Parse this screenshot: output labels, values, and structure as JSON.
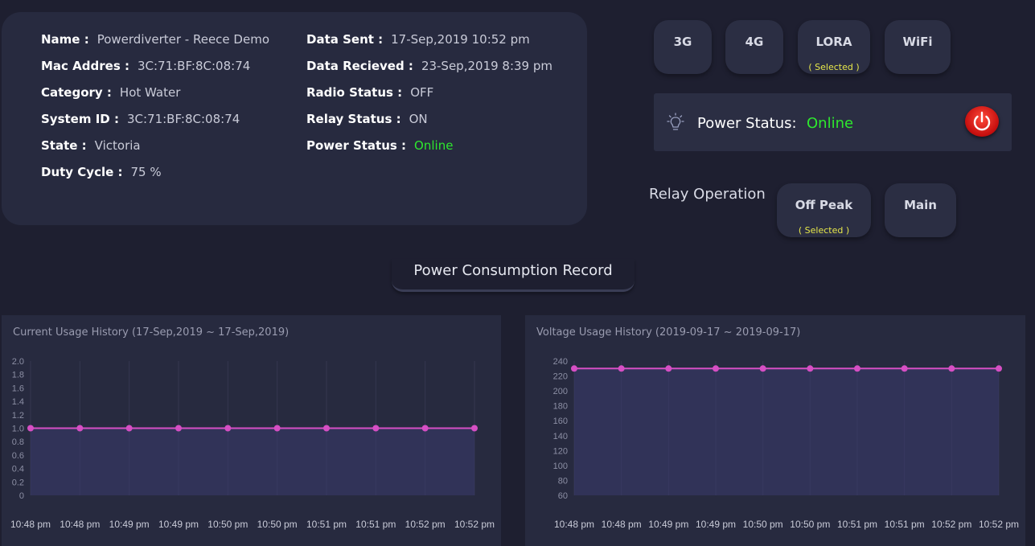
{
  "device": {
    "left": [
      {
        "label": "Name :",
        "value": "Powerdiverter - Reece Demo"
      },
      {
        "label": "Mac Addres :",
        "value": "3C:71:BF:8C:08:74"
      },
      {
        "label": "Category :",
        "value": "Hot Water"
      },
      {
        "label": "System ID :",
        "value": "3C:71:BF:8C:08:74"
      },
      {
        "label": "State :",
        "value": "Victoria"
      },
      {
        "label": "Duty Cycle :",
        "value": "75 %"
      }
    ],
    "right": [
      {
        "label": "Data Sent :",
        "value": "17-Sep,2019 10:52 pm"
      },
      {
        "label": "Data Recieved :",
        "value": "23-Sep,2019 8:39 pm"
      },
      {
        "label": "Radio Status :",
        "value": "OFF"
      },
      {
        "label": "Relay Status :",
        "value": "ON"
      },
      {
        "label": "Power Status :",
        "value": "Online"
      }
    ]
  },
  "network": {
    "buttons": [
      "3G",
      "4G",
      "LORA",
      "WiFi"
    ],
    "selected_note": "( Selected )"
  },
  "power_panel": {
    "label": "Power Status:",
    "value": "Online"
  },
  "relay": {
    "title": "Relay Operation",
    "buttons": [
      "Off Peak",
      "Main"
    ],
    "selected_note": "( Selected )"
  },
  "section_title": "Power Consumption Record",
  "colors": {
    "online": "#2ee82e",
    "selected": "#e6e74a",
    "series": "#d64fc4",
    "power_button": "#d21010"
  },
  "chart_data": [
    {
      "type": "area",
      "title": "Current Usage History (17-Sep,2019 ~ 17-Sep,2019)",
      "categories": [
        "10:48 pm",
        "10:48 pm",
        "10:49 pm",
        "10:49 pm",
        "10:50 pm",
        "10:50 pm",
        "10:51 pm",
        "10:51 pm",
        "10:52 pm",
        "10:52 pm"
      ],
      "values": [
        1.0,
        1.0,
        1.0,
        1.0,
        1.0,
        1.0,
        1.0,
        1.0,
        1.0,
        1.0
      ],
      "yticks": [
        "0",
        "0.2",
        "0.4",
        "0.6",
        "0.8",
        "1.0",
        "1.2",
        "1.4",
        "1.6",
        "1.8",
        "2.0"
      ],
      "ylim": [
        0,
        2.0
      ]
    },
    {
      "type": "area",
      "title": "Voltage Usage History (2019-09-17 ~ 2019-09-17)",
      "categories": [
        "10:48 pm",
        "10:48 pm",
        "10:49 pm",
        "10:49 pm",
        "10:50 pm",
        "10:50 pm",
        "10:51 pm",
        "10:51 pm",
        "10:52 pm",
        "10:52 pm"
      ],
      "values": [
        230,
        230,
        230,
        230,
        230,
        230,
        230,
        230,
        230,
        230
      ],
      "yticks": [
        "60",
        "80",
        "100",
        "120",
        "140",
        "160",
        "180",
        "200",
        "220",
        "240"
      ],
      "ylim": [
        60,
        240
      ]
    }
  ]
}
